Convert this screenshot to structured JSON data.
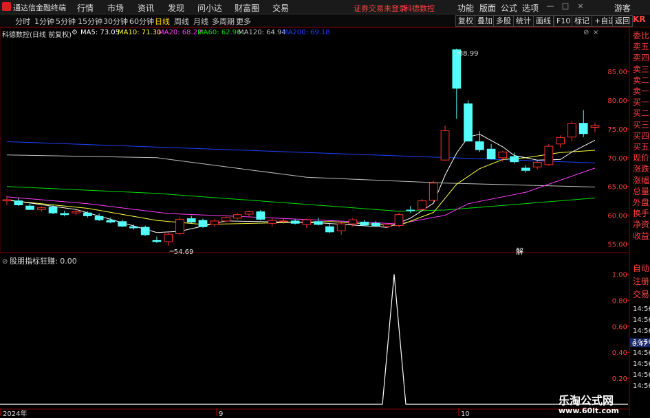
{
  "app": {
    "title": "通达信金融终端",
    "notice_trade": "证券交易未登录",
    "notice_stock": "科德数控"
  },
  "menu": [
    "行情",
    "市场",
    "资讯",
    "发现",
    "问小达",
    "财富圈",
    "交易"
  ],
  "right_menu": [
    "功能",
    "版面",
    "公式",
    "选项"
  ],
  "guest": "游客",
  "win_buttons": {
    "minimize": "—",
    "maximize": "□",
    "close": "×"
  },
  "periods": [
    "分时",
    "1分钟",
    "5分钟",
    "15分钟",
    "30分钟",
    "60分钟",
    "日线",
    "周线",
    "月线",
    "多周期",
    "更多"
  ],
  "active_period": "日线",
  "toolbar": [
    "复权",
    "叠加",
    "多股",
    "统计",
    "画线",
    "F10",
    "标记",
    "+自选",
    "返回"
  ],
  "main_chart": {
    "title": "科德数控(日线 前复权)",
    "ma": [
      {
        "label": "MA5: 73.05",
        "color": "#ffffff"
      },
      {
        "label": "MA10: 71.30",
        "color": "#ffff40"
      },
      {
        "label": "MA20: 68.22",
        "color": "#ff40ff"
      },
      {
        "label": "MA60: 62.96",
        "color": "#00e000"
      },
      {
        "label": "MA120: 64.94",
        "color": "#c0c0c0"
      },
      {
        "label": "MA200: 69.18",
        "color": "#2040ff"
      }
    ],
    "high_label": "88.99",
    "low_label": "54.69",
    "y_ticks": [
      "85.00",
      "80.00",
      "75.00",
      "70.00",
      "65.00",
      "60.00",
      "55.00"
    ],
    "marker": "解"
  },
  "indicator": {
    "title": "股朋指标",
    "value_label": "狂赚: 0.00",
    "y_ticks": [
      "1.00",
      "0.80",
      "0.60",
      "0.40",
      "0.20"
    ],
    "current": "0.47"
  },
  "x_labels": [
    "2024年",
    "9",
    "10"
  ],
  "right_panel": {
    "labels": [
      "委比",
      "卖五",
      "卖四",
      "卖三",
      "卖二",
      "卖一",
      "买一",
      "买二",
      "买三",
      "买四",
      "买五",
      "现价",
      "涨跌",
      "涨幅",
      "总量",
      "外盘",
      "换手",
      "净资",
      "收益"
    ],
    "lower_labels": [
      "自动",
      "注册",
      "交易"
    ],
    "times": [
      "14:56",
      "14:56",
      "14:56",
      "14:56",
      "14:56",
      "14:56",
      "14:56",
      "14:56"
    ],
    "code_tag": "KR"
  },
  "watermark": {
    "line1": "乐淘公式网",
    "line2": "www.60lt.com"
  },
  "colors": {
    "up": "#ff3232",
    "down": "#54fcfc",
    "ma5": "#ffffff",
    "ma10": "#ffff40",
    "ma20": "#ff40ff",
    "ma60": "#00e000",
    "ma120": "#c0c0c0",
    "ma200": "#2040ff",
    "grid": "#800000"
  },
  "chart_data": {
    "type": "candlestick",
    "series": [
      {
        "o": 62.5,
        "h": 63.4,
        "l": 61.8,
        "c": 62.7
      },
      {
        "o": 62.5,
        "h": 63.0,
        "l": 61.6,
        "c": 61.8
      },
      {
        "o": 61.6,
        "h": 62.2,
        "l": 60.9,
        "c": 61.0
      },
      {
        "o": 61.0,
        "h": 61.6,
        "l": 60.6,
        "c": 61.3
      },
      {
        "o": 61.4,
        "h": 61.8,
        "l": 60.2,
        "c": 60.4
      },
      {
        "o": 60.3,
        "h": 60.8,
        "l": 59.8,
        "c": 60.1
      },
      {
        "o": 60.4,
        "h": 60.9,
        "l": 60.0,
        "c": 60.6
      },
      {
        "o": 60.4,
        "h": 60.7,
        "l": 59.6,
        "c": 59.9
      },
      {
        "o": 59.8,
        "h": 60.3,
        "l": 59.0,
        "c": 59.2
      },
      {
        "o": 59.1,
        "h": 59.6,
        "l": 58.6,
        "c": 58.8
      },
      {
        "o": 58.9,
        "h": 59.2,
        "l": 57.9,
        "c": 58.1
      },
      {
        "o": 58.0,
        "h": 58.4,
        "l": 57.5,
        "c": 57.8
      },
      {
        "o": 57.9,
        "h": 58.2,
        "l": 56.4,
        "c": 56.6
      },
      {
        "o": 55.6,
        "h": 56.3,
        "l": 55.2,
        "c": 55.4
      },
      {
        "o": 55.4,
        "h": 56.9,
        "l": 54.7,
        "c": 56.7
      },
      {
        "o": 56.8,
        "h": 59.6,
        "l": 56.5,
        "c": 59.3
      },
      {
        "o": 59.4,
        "h": 59.9,
        "l": 58.5,
        "c": 58.8
      },
      {
        "o": 59.1,
        "h": 59.4,
        "l": 57.8,
        "c": 58.0
      },
      {
        "o": 58.4,
        "h": 59.3,
        "l": 58.0,
        "c": 59.0
      },
      {
        "o": 59.0,
        "h": 59.9,
        "l": 58.7,
        "c": 59.6
      },
      {
        "o": 59.5,
        "h": 60.3,
        "l": 59.2,
        "c": 60.1
      },
      {
        "o": 60.2,
        "h": 60.8,
        "l": 59.8,
        "c": 60.6
      },
      {
        "o": 60.6,
        "h": 60.9,
        "l": 59.1,
        "c": 59.3
      },
      {
        "o": 58.6,
        "h": 59.5,
        "l": 58.0,
        "c": 59.1
      },
      {
        "o": 58.9,
        "h": 59.4,
        "l": 58.5,
        "c": 59.0
      },
      {
        "o": 59.0,
        "h": 59.3,
        "l": 58.4,
        "c": 58.6
      },
      {
        "o": 58.4,
        "h": 59.4,
        "l": 57.8,
        "c": 59.2
      },
      {
        "o": 58.9,
        "h": 59.6,
        "l": 58.2,
        "c": 58.4
      },
      {
        "o": 58.0,
        "h": 58.5,
        "l": 56.9,
        "c": 57.1
      },
      {
        "o": 57.3,
        "h": 58.7,
        "l": 56.6,
        "c": 58.5
      },
      {
        "o": 58.5,
        "h": 59.5,
        "l": 58.0,
        "c": 59.2
      },
      {
        "o": 58.8,
        "h": 59.2,
        "l": 58.1,
        "c": 58.3
      },
      {
        "o": 58.6,
        "h": 59.0,
        "l": 58.0,
        "c": 58.2
      },
      {
        "o": 58.0,
        "h": 58.6,
        "l": 57.8,
        "c": 58.4
      },
      {
        "o": 58.2,
        "h": 60.4,
        "l": 57.9,
        "c": 60.1
      },
      {
        "o": 60.9,
        "h": 61.6,
        "l": 60.4,
        "c": 60.8
      },
      {
        "o": 61.0,
        "h": 62.8,
        "l": 60.9,
        "c": 62.5
      },
      {
        "o": 62.6,
        "h": 66.0,
        "l": 62.3,
        "c": 65.6
      },
      {
        "o": 69.6,
        "h": 75.6,
        "l": 69.5,
        "c": 74.7
      },
      {
        "o": 88.8,
        "h": 88.99,
        "l": 76.8,
        "c": 82.1
      },
      {
        "o": 79.4,
        "h": 80.0,
        "l": 73.6,
        "c": 72.9
      },
      {
        "o": 72.8,
        "h": 74.6,
        "l": 71.0,
        "c": 71.4
      },
      {
        "o": 71.5,
        "h": 72.4,
        "l": 69.7,
        "c": 69.8
      },
      {
        "o": 70.0,
        "h": 71.2,
        "l": 69.3,
        "c": 71.0
      },
      {
        "o": 70.2,
        "h": 70.9,
        "l": 69.0,
        "c": 69.3
      },
      {
        "o": 68.2,
        "h": 68.7,
        "l": 67.4,
        "c": 67.8
      },
      {
        "o": 68.4,
        "h": 69.5,
        "l": 68.0,
        "c": 69.2
      },
      {
        "o": 68.8,
        "h": 72.4,
        "l": 68.6,
        "c": 72.0
      },
      {
        "o": 72.4,
        "h": 73.9,
        "l": 71.8,
        "c": 73.5
      },
      {
        "o": 73.6,
        "h": 76.4,
        "l": 72.9,
        "c": 76.0
      },
      {
        "o": 76.0,
        "h": 78.3,
        "l": 73.6,
        "c": 74.2
      },
      {
        "o": 75.3,
        "h": 76.1,
        "l": 74.4,
        "c": 75.6
      }
    ],
    "ma": {
      "ma200": [
        [
          0,
          72.8
        ],
        [
          51,
          69.1
        ]
      ],
      "ma120": [
        [
          0,
          70.5
        ],
        [
          13,
          70.0
        ],
        [
          26,
          66.6
        ],
        [
          38,
          65.6
        ],
        [
          51,
          64.9
        ]
      ],
      "ma60": [
        [
          0,
          65.0
        ],
        [
          13,
          63.8
        ],
        [
          26,
          61.9
        ],
        [
          34,
          60.7
        ],
        [
          38,
          60.9
        ],
        [
          51,
          63.0
        ]
      ],
      "ma20": [
        [
          0,
          63.2
        ],
        [
          7,
          62.0
        ],
        [
          14,
          60.3
        ],
        [
          20,
          59.8
        ],
        [
          34,
          58.5
        ],
        [
          38,
          60.0
        ],
        [
          40,
          62.0
        ],
        [
          45,
          64.0
        ],
        [
          51,
          68.2
        ]
      ],
      "ma10": [
        [
          0,
          62.6
        ],
        [
          7,
          61.2
        ],
        [
          13,
          59.1
        ],
        [
          17,
          58.4
        ],
        [
          28,
          58.9
        ],
        [
          34,
          58.2
        ],
        [
          37,
          60.5
        ],
        [
          39,
          65.4
        ],
        [
          41,
          68.1
        ],
        [
          43,
          69.7
        ],
        [
          45,
          70.0
        ],
        [
          48,
          70.9
        ],
        [
          51,
          71.3
        ]
      ],
      "ma5": [
        [
          0,
          62.7
        ],
        [
          6,
          61.0
        ],
        [
          13,
          57.0
        ],
        [
          15,
          57.2
        ],
        [
          19,
          59.0
        ],
        [
          27,
          58.7
        ],
        [
          33,
          57.9
        ],
        [
          35,
          59.5
        ],
        [
          37,
          62.1
        ],
        [
          38,
          67.0
        ],
        [
          39,
          70.8
        ],
        [
          40,
          73.6
        ],
        [
          41,
          74.1
        ],
        [
          43,
          71.9
        ],
        [
          44,
          70.4
        ],
        [
          46,
          69.6
        ],
        [
          48,
          69.7
        ],
        [
          49,
          71.0
        ],
        [
          51,
          73.05
        ]
      ]
    },
    "indicator_series": {
      "name": "狂赚",
      "x": [
        0,
        30,
        31,
        32,
        51
      ],
      "y": [
        0,
        0,
        1,
        0,
        0
      ]
    },
    "ylim": [
      53.5,
      91
    ],
    "indicator_ylim": [
      0,
      1.05
    ]
  }
}
